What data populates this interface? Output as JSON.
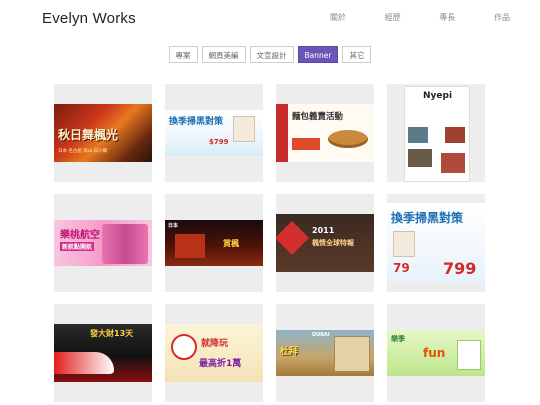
{
  "header": {
    "brand": "Evelyn Works"
  },
  "nav": [
    {
      "label": "關於",
      "name": "nav-about"
    },
    {
      "label": "經歷",
      "name": "nav-experience"
    },
    {
      "label": "專長",
      "name": "nav-skills"
    },
    {
      "label": "作品",
      "name": "nav-works"
    }
  ],
  "filters": [
    {
      "label": "專案",
      "active": false
    },
    {
      "label": "網頁美編",
      "active": false
    },
    {
      "label": "文宣設計",
      "active": false
    },
    {
      "label": "Banner",
      "active": true
    },
    {
      "label": "其它",
      "active": false
    }
  ],
  "colors": {
    "accent": "#6b56b8",
    "tile_bg": "#ededed"
  },
  "gallery": [
    {
      "name": "banner-autumn-japan",
      "lines": [
        "秋日舞楓光",
        "日本·名古屋·高山·白川鄉"
      ]
    },
    {
      "name": "banner-season-promo",
      "lines": [
        "換季掃黑對策",
        "$799"
      ]
    },
    {
      "name": "banner-bread-event",
      "lines": [
        "麵包義賣活動"
      ]
    },
    {
      "name": "banner-nyepi-poster",
      "lines": [
        "Nyepi"
      ]
    },
    {
      "name": "banner-peach-airline",
      "lines": [
        "樂桃航空",
        "新航點開航"
      ]
    },
    {
      "name": "banner-japan-night",
      "lines": [
        "日本",
        "賞楓"
      ]
    },
    {
      "name": "banner-2011-sale",
      "lines": [
        "2011",
        "楓情全球特報"
      ]
    },
    {
      "name": "banner-season-promo-2",
      "lines": [
        "換季掃黑對策",
        "79",
        "799"
      ]
    },
    {
      "name": "banner-travel-13",
      "lines": [
        "發大財13天"
      ]
    },
    {
      "name": "banner-sale-discount",
      "lines": [
        "就降玩",
        "最高折1萬"
      ]
    },
    {
      "name": "banner-dubai",
      "lines": [
        "DUBAI",
        "杜拜"
      ]
    },
    {
      "name": "banner-fun",
      "lines": [
        "樂季",
        "fun"
      ]
    }
  ]
}
